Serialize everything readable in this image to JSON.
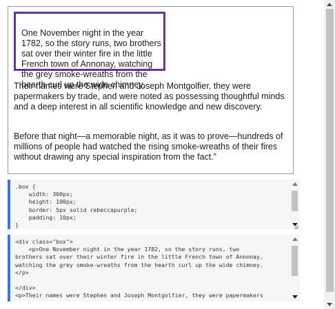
{
  "preview": {
    "box_paragraph": "One November night in the year 1782, so the story runs, two brothers sat over their winter fire in the little French town of Annonay, watching the grey smoke-wreaths from the hearth curl up the wide chimney.",
    "paragraph_2": "Their names were Stephen and Joseph Montgolfier, they were papermakers by trade, and were noted as possessing thoughtful minds and a deep interest in all scientific knowledge and new discovery.",
    "paragraph_3": "Before that night—a memorable night, as it was to prove—hundreds of millions of people had watched the rising smoke-wreaths of their fires without drawing any special inspiration from the fact.”",
    "box_border_color": "#663399"
  },
  "css_editor": {
    "code": ".box {\n    width: 300px;\n    height: 100px;\n    border: 5px solid rebeccapurple;\n    padding: 10px;\n}"
  },
  "html_editor": {
    "code": "<div class=\"box\">\n    <p>One November night in the year 1782, so the story runs, two\nbrothers sat over their winter fire in the little French town of Annonay,\nwatching the grey smoke-wreaths from the hearth curl up the wide chimney.\n</p>\n\n</div>\n<p>Their names were Stephen and Joseph Montgolfier, they were papermakers"
  },
  "colors": {
    "editor_accent": "#3e76c8",
    "editor_background": "#f4f5f7"
  }
}
